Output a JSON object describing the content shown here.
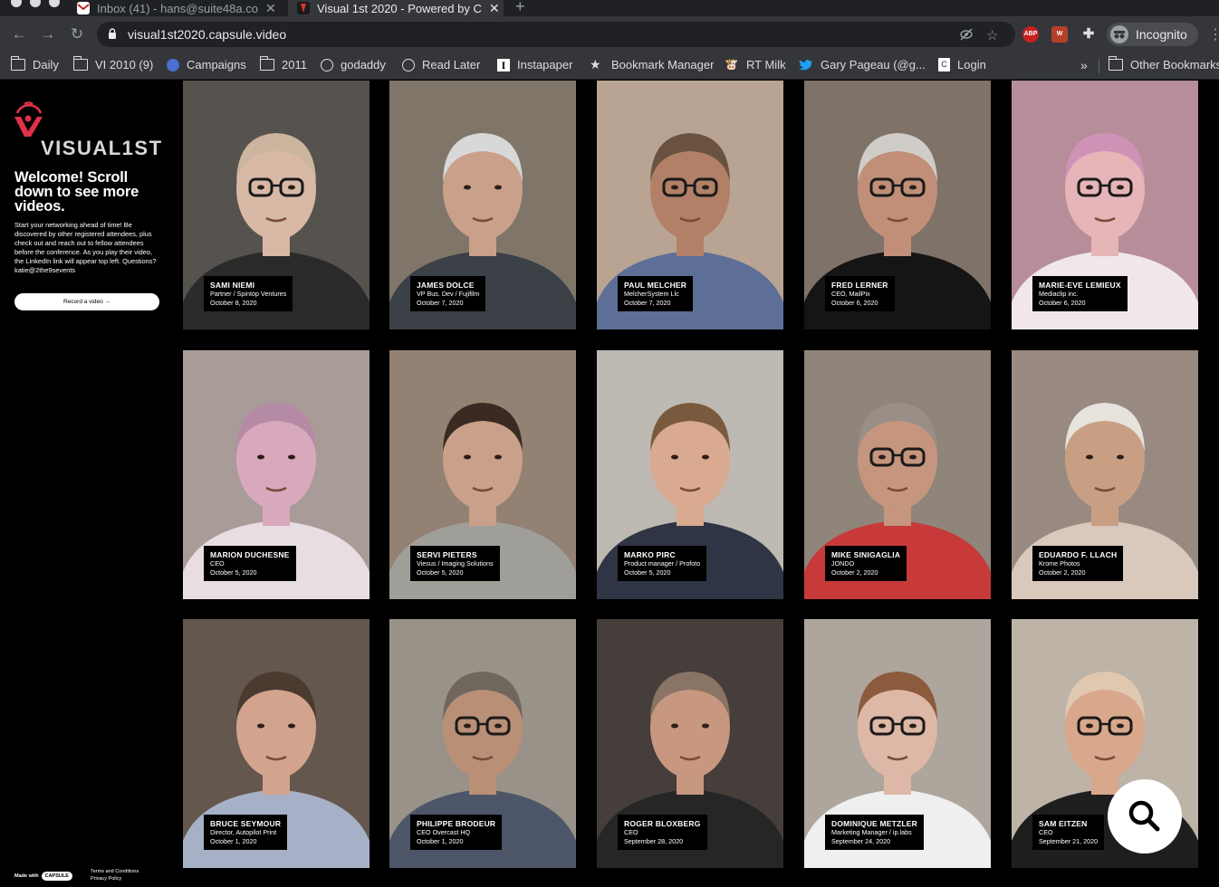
{
  "browser": {
    "tabs": [
      {
        "title": "Inbox (41) - hans@suite48a.co",
        "active": false,
        "favicon_color": "#c5221f"
      },
      {
        "title": "Visual 1st 2020 - Powered by C",
        "active": true,
        "favicon_color": "#d23"
      }
    ],
    "url": "visual1st2020.capsule.video",
    "extensions": [
      {
        "label": "ABP",
        "color": "#c5221f"
      },
      {
        "label": "W",
        "color": "#b5402a"
      }
    ],
    "profile_label": "Incognito",
    "bookmarks": [
      {
        "label": "Daily",
        "icon": "folder-icon"
      },
      {
        "label": "VI 2010 (9)",
        "icon": "folder-icon"
      },
      {
        "label": "Campaigns",
        "icon": "globe-icon"
      },
      {
        "label": "2011",
        "icon": "folder-icon"
      },
      {
        "label": "godaddy",
        "icon": "globe-icon"
      },
      {
        "label": "Read Later",
        "icon": "globe-icon"
      },
      {
        "label": "Instapaper",
        "icon": "instapaper-icon"
      },
      {
        "label": "Bookmark Manager",
        "icon": "star-icon"
      },
      {
        "label": "RT Milk",
        "icon": "cow-icon"
      },
      {
        "label": "Gary Pageau (@g...",
        "icon": "twitter-icon"
      },
      {
        "label": "Login",
        "icon": "page-icon"
      }
    ],
    "bookmarks_overflow": "»",
    "other_bookmarks": "Other Bookmarks"
  },
  "sidebar": {
    "logo_text": "VISUAL1ST",
    "welcome": "Welcome! Scroll down to see more videos.",
    "intro": "Start your networking ahead of time! Be discovered by other registered attendees, plus check out and reach out to fellow attendees before the conference. As you play their video, the LinkedIn link will appear top left. Questions? katie@2the9sevents",
    "record_button": "Record a video →",
    "made_with": "Made with",
    "capsule_badge": "CAPSULE",
    "terms": "Terms and Conditions",
    "privacy": "Privacy Policy"
  },
  "videos": [
    {
      "name": "SAMI NIEMI",
      "role": "Partner / Spintop Ventures",
      "date": "October 8, 2020",
      "bg": "#5e5a55",
      "face": "#d7b9a6",
      "shirt": "#2a2a2a",
      "hair": "#cbb59e",
      "glasses": true
    },
    {
      "name": "JAMES DOLCE",
      "role": "VP Bus. Dev / Fujifilm",
      "date": "October 7, 2020",
      "bg": "#8a8072",
      "face": "#c9a08a",
      "shirt": "#3c4047",
      "hair": "#d8d8d8",
      "glasses": false
    },
    {
      "name": "PAUL MELCHER",
      "role": "MelcherSystem Llc",
      "date": "October 7, 2020",
      "bg": "#c9b2a0",
      "face": "#b18067",
      "shirt": "#5d6f96",
      "hair": "#6a5240",
      "glasses": true
    },
    {
      "name": "FRED LERNER",
      "role": "CEO, MailPix",
      "date": "October 6, 2020",
      "bg": "#8a7c72",
      "face": "#c18f78",
      "shirt": "#151515",
      "hair": "#d0cdc8",
      "glasses": true
    },
    {
      "name": "MARIE-EVE LEMIEUX",
      "role": "Mediaclip inc.",
      "date": "October 6, 2020",
      "bg": "#c69aa6",
      "face": "#e6b5b7",
      "shirt": "#f1e6ea",
      "hair": "#cf93b8",
      "glasses": true
    },
    {
      "name": "MARION DUCHESNE",
      "role": "CEO",
      "date": "October 5, 2020",
      "bg": "#b8a9a4",
      "face": "#d8a9bc",
      "shirt": "#e8dde3",
      "hair": "#b58aa5",
      "glasses": false
    },
    {
      "name": "SERVI PIETERS",
      "role": "Viesus / Imaging Solutions",
      "date": "October 5, 2020",
      "bg": "#a08c7e",
      "face": "#c9a089",
      "shirt": "#a09e98",
      "hair": "#3a2a22",
      "glasses": false
    },
    {
      "name": "MARKO PIRC",
      "role": "Product manager / Profoto",
      "date": "October 5, 2020",
      "bg": "#cfc9c2",
      "face": "#d9aa8f",
      "shirt": "#2f3544",
      "hair": "#7a5a3e",
      "glasses": false
    },
    {
      "name": "MIKE SINIGAGLIA",
      "role": "JONDO",
      "date": "October 2, 2020",
      "bg": "#9c9186",
      "face": "#c6957e",
      "shirt": "#c83a3a",
      "hair": "#9a8f86",
      "glasses": true
    },
    {
      "name": "EDUARDO F. LLACH",
      "role": "Krome Photos",
      "date": "October 2, 2020",
      "bg": "#a5968c",
      "face": "#c99f84",
      "shirt": "#d9c8bc",
      "hair": "#e8e2dc",
      "glasses": false
    },
    {
      "name": "BRUCE SEYMOUR",
      "role": "Director, Autopilot Print",
      "date": "October 1, 2020",
      "bg": "#6d5f55",
      "face": "#d2a48d",
      "shirt": "#a6b1c7",
      "hair": "#4a3a30",
      "glasses": false
    },
    {
      "name": "PHILIPPE BRODEUR",
      "role": "CEO Overcast HQ",
      "date": "October 1, 2020",
      "bg": "#a59f94",
      "face": "#b98f76",
      "shirt": "#4c5668",
      "hair": "#6f665e",
      "glasses": true
    },
    {
      "name": "ROGER BLOXBERG",
      "role": "CEO",
      "date": "September 28, 2020",
      "bg": "#4d4440",
      "face": "#c8977f",
      "shirt": "#262626",
      "hair": "#8a7466",
      "glasses": false
    },
    {
      "name": "DOMINIQUE METZLER",
      "role": "Marketing Manager / ip.labs",
      "date": "September 24, 2020",
      "bg": "#bdb4ab",
      "face": "#ddb8a6",
      "shirt": "#efefef",
      "hair": "#8c5a3c",
      "glasses": true
    },
    {
      "name": "SAM EITZEN",
      "role": "CEO",
      "date": "September 21, 2020",
      "bg": "#cfc3b6",
      "face": "#d9a88c",
      "shirt": "#1e1e1e",
      "hair": "#e0c8b0",
      "glasses": true
    }
  ],
  "search_fab": {
    "icon": "search-icon"
  }
}
